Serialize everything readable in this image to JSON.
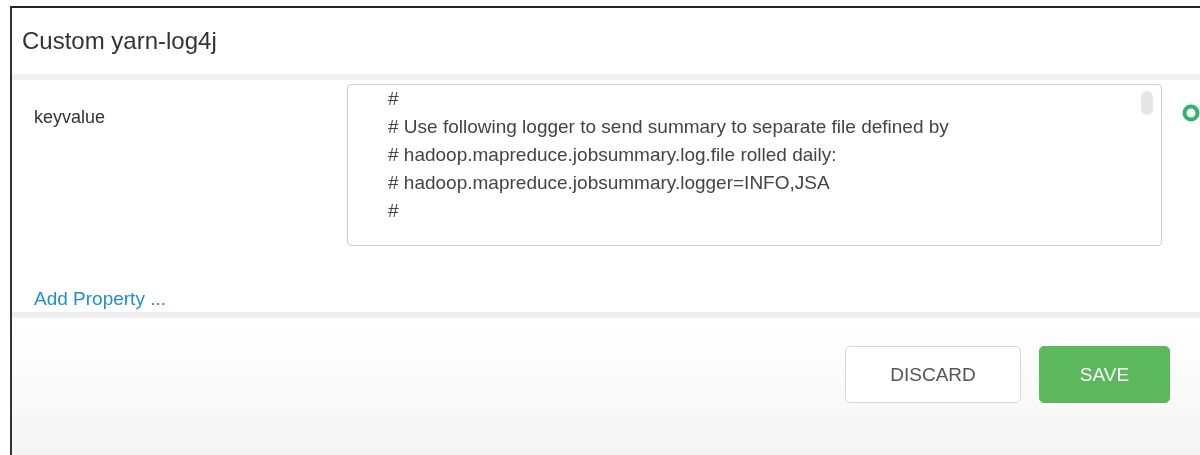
{
  "dialog": {
    "title": "Custom yarn-log4j"
  },
  "properties": [
    {
      "name": "keyvalue",
      "value": "#\n# Use following logger to send summary to separate file defined by\n# hadoop.mapreduce.jobsummary.log.file rolled daily:\n# hadoop.mapreduce.jobsummary.logger=INFO,JSA\n#"
    }
  ],
  "add_link": "Add Property ...",
  "buttons": [
    {
      "label": "DISCARD",
      "kind": "secondary"
    },
    {
      "label": "SAVE",
      "kind": "primary"
    }
  ]
}
